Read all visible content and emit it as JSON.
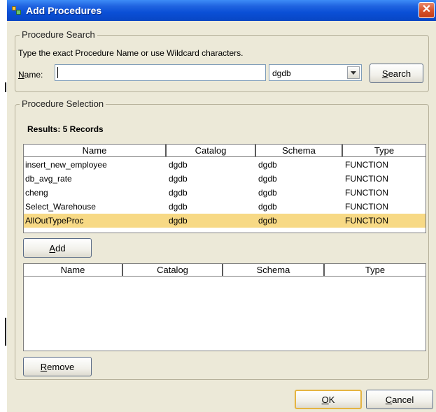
{
  "window": {
    "title": "Add Procedures",
    "close_glyph": "✕"
  },
  "search": {
    "legend": "Procedure Search",
    "hint": "Type the exact Procedure Name or use Wildcard characters.",
    "name_label_first": "N",
    "name_label_rest": "ame:",
    "name_value": "",
    "catalog_value": "dgdb",
    "search_button": "Search",
    "search_button_mnemonic": "S",
    "search_button_rest": "earch"
  },
  "selection": {
    "legend": "Procedure Selection",
    "results_label": "Results: 5 Records",
    "columns": [
      "Name",
      "Catalog",
      "Schema",
      "Type"
    ],
    "rows": [
      {
        "name": "insert_new_employee",
        "catalog": "dgdb",
        "schema": "dgdb",
        "type": "FUNCTION"
      },
      {
        "name": "db_avg_rate",
        "catalog": "dgdb",
        "schema": "dgdb",
        "type": "FUNCTION"
      },
      {
        "name": "cheng",
        "catalog": "dgdb",
        "schema": "dgdb",
        "type": "FUNCTION"
      },
      {
        "name": "Select_Warehouse",
        "catalog": "dgdb",
        "schema": "dgdb",
        "type": "FUNCTION"
      },
      {
        "name": "AllOutTypeProc",
        "catalog": "dgdb",
        "schema": "dgdb",
        "type": "FUNCTION",
        "selected": true
      }
    ],
    "add_mnemonic": "A",
    "add_rest": "dd",
    "selected_columns": [
      "Name",
      "Catalog",
      "Schema",
      "Type"
    ],
    "remove_mnemonic": "R",
    "remove_rest": "emove"
  },
  "footer": {
    "ok_mnemonic": "O",
    "ok_rest": "K",
    "cancel_mnemonic": "C",
    "cancel_rest": "ancel"
  },
  "colors": {
    "titlebar": "#0a4fd6",
    "dialog_bg": "#ece9d8",
    "selected_row": "#f7d985",
    "default_button_border": "#e5b441"
  }
}
